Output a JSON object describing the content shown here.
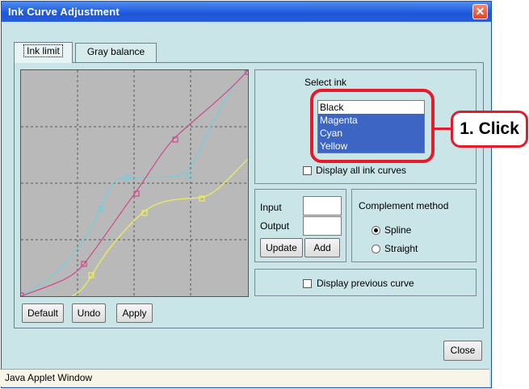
{
  "window": {
    "title": "Ink Curve Adjustment"
  },
  "tabs": [
    {
      "label": "Ink limit",
      "active": true
    },
    {
      "label": "Gray balance",
      "active": false
    }
  ],
  "select_ink": {
    "label": "Select ink",
    "items": [
      {
        "label": "Black",
        "selected": false
      },
      {
        "label": "Magenta",
        "selected": true
      },
      {
        "label": "Cyan",
        "selected": true
      },
      {
        "label": "Yellow",
        "selected": true
      }
    ],
    "display_all_label": "Display all ink curves"
  },
  "io": {
    "input_label": "Input",
    "output_label": "Output",
    "input_value": "",
    "output_value": "",
    "update_label": "Update",
    "add_label": "Add"
  },
  "complement": {
    "title": "Complement method",
    "options": [
      "Spline",
      "Straight"
    ],
    "selected": "Spline"
  },
  "display_previous_label": "Display previous curve",
  "graph_buttons": {
    "default": "Default",
    "undo": "Undo",
    "apply": "Apply"
  },
  "close_label": "Close",
  "status_bar": "Java Applet Window",
  "annotation": {
    "text": "1. Click",
    "color": "#e31b2a"
  },
  "curve_colors": {
    "magenta": "#cc4a8a",
    "cyan": "#6fd0e0",
    "yellow": "#f0f050"
  }
}
